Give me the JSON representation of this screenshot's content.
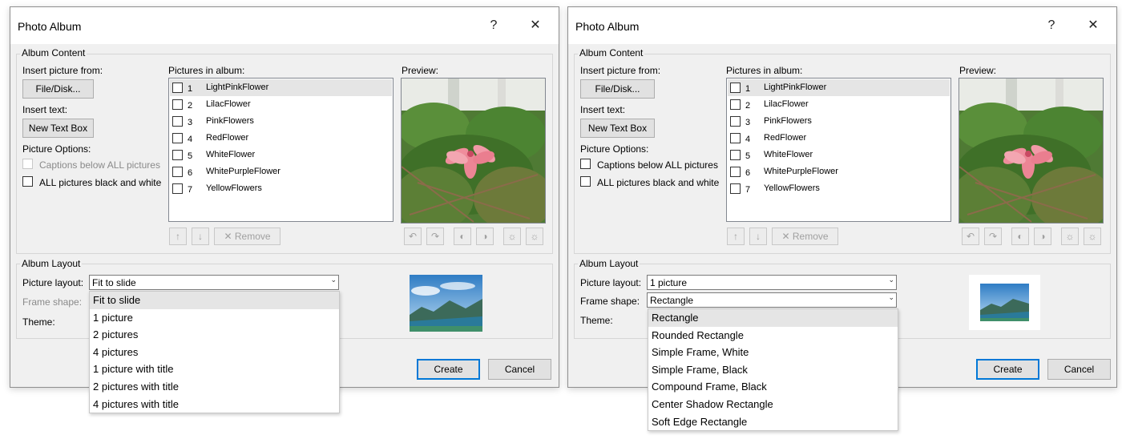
{
  "title": "Photo Album",
  "help_glyph": "?",
  "close_glyph": "✕",
  "album_content": "Album Content",
  "insert_picture_from": "Insert picture from:",
  "file_disk": "File/Disk...",
  "insert_text": "Insert text:",
  "new_text_box": "New Text Box",
  "picture_options": "Picture Options:",
  "captions_below": "Captions below ALL pictures",
  "all_black_white": "ALL pictures black and white",
  "pictures_in_album": "Pictures in album:",
  "preview": "Preview:",
  "pictures": [
    {
      "num": "1",
      "name": "LightPinkFlower"
    },
    {
      "num": "2",
      "name": "LilacFlower"
    },
    {
      "num": "3",
      "name": "PinkFlowers"
    },
    {
      "num": "4",
      "name": "RedFlower"
    },
    {
      "num": "5",
      "name": "WhiteFlower"
    },
    {
      "num": "6",
      "name": "WhitePurpleFlower"
    },
    {
      "num": "7",
      "name": "YellowFlowers"
    }
  ],
  "remove": "Remove",
  "up_glyph": "↑",
  "down_glyph": "↓",
  "remove_glyph": "✕",
  "album_layout": "Album Layout",
  "picture_layout_label": "Picture layout:",
  "frame_shape_label": "Frame shape:",
  "theme_label": "Theme:",
  "create": "Create",
  "cancel": "Cancel",
  "left_dialog": {
    "picture_layout_value": "Fit to slide",
    "layout_options": [
      "Fit to slide",
      "1 picture",
      "2 pictures",
      "4 pictures",
      "1 picture with title",
      "2 pictures with title",
      "4 pictures with title"
    ]
  },
  "right_dialog": {
    "picture_layout_value": "1 picture",
    "frame_shape_value": "Rectangle",
    "frame_options": [
      "Rectangle",
      "Rounded Rectangle",
      "Simple Frame, White",
      "Simple Frame, Black",
      "Compound Frame, Black",
      "Center Shadow Rectangle",
      "Soft Edge Rectangle"
    ]
  },
  "icons": [
    "rotate-left-icon",
    "rotate-right-icon",
    "contrast-up-icon",
    "contrast-down-icon",
    "brightness-up-icon",
    "brightness-down-icon",
    "up-arrow-icon",
    "down-arrow-icon",
    "dropdown-arrow-icon"
  ],
  "colors": {
    "dialog_bg": "#f0f0f0",
    "accent": "#0078d7",
    "selected_row": "#e5e5e5"
  }
}
